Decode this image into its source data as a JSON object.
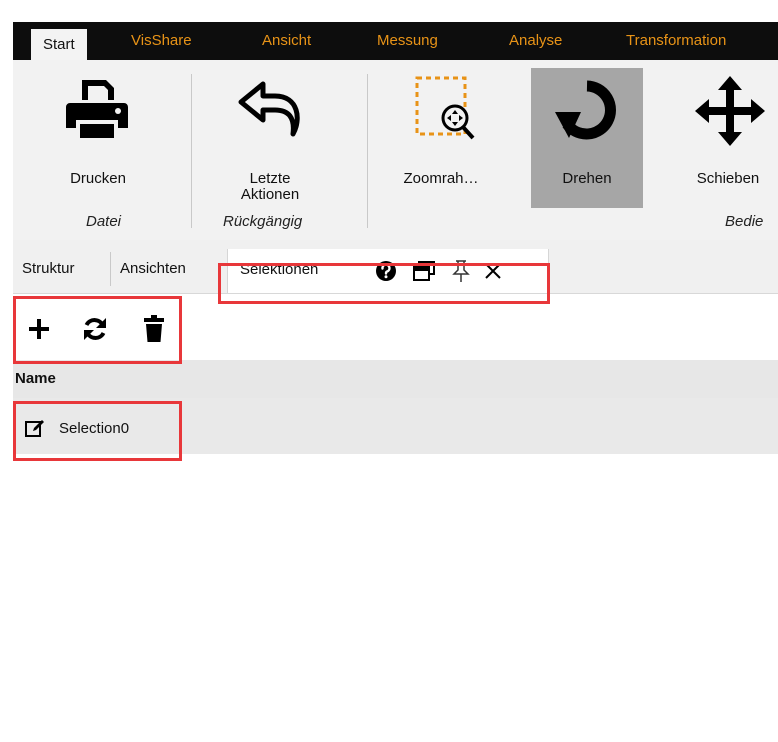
{
  "menu_tabs": [
    "Start",
    "VisShare",
    "Ansicht",
    "Messung",
    "Analyse",
    "Transformation"
  ],
  "ribbon": {
    "print_label": "Drucken",
    "undo_label_line1": "Letzte",
    "undo_label_line2": "Aktionen",
    "zoom_label": "Zoomrah…",
    "rotate_label": "Drehen",
    "move_label": "Schieben",
    "group_file": "Datei",
    "group_undo": "Rückgängig",
    "group_operate": "Bedie"
  },
  "panel_tabs": {
    "structure": "Struktur",
    "views": "Ansichten",
    "selections": "Selektionen"
  },
  "table": {
    "column_name": "Name",
    "rows": [
      "Selection0"
    ]
  },
  "colors": {
    "menu_bg": "#0d0d0d",
    "menu_text": "#e89317",
    "ribbon_bg": "#f2f2f2",
    "pressed_bg": "#a6a6a6",
    "highlight": "#e8373a",
    "zoom_frame": "#e89317"
  },
  "icons": [
    "printer-icon",
    "undo-arrow-icon",
    "zoom-frame-icon",
    "rotate-icon",
    "move-arrows-icon",
    "help-icon",
    "window-icon",
    "pin-icon",
    "close-icon",
    "plus-icon",
    "refresh-icon",
    "trash-icon",
    "edit-icon"
  ]
}
